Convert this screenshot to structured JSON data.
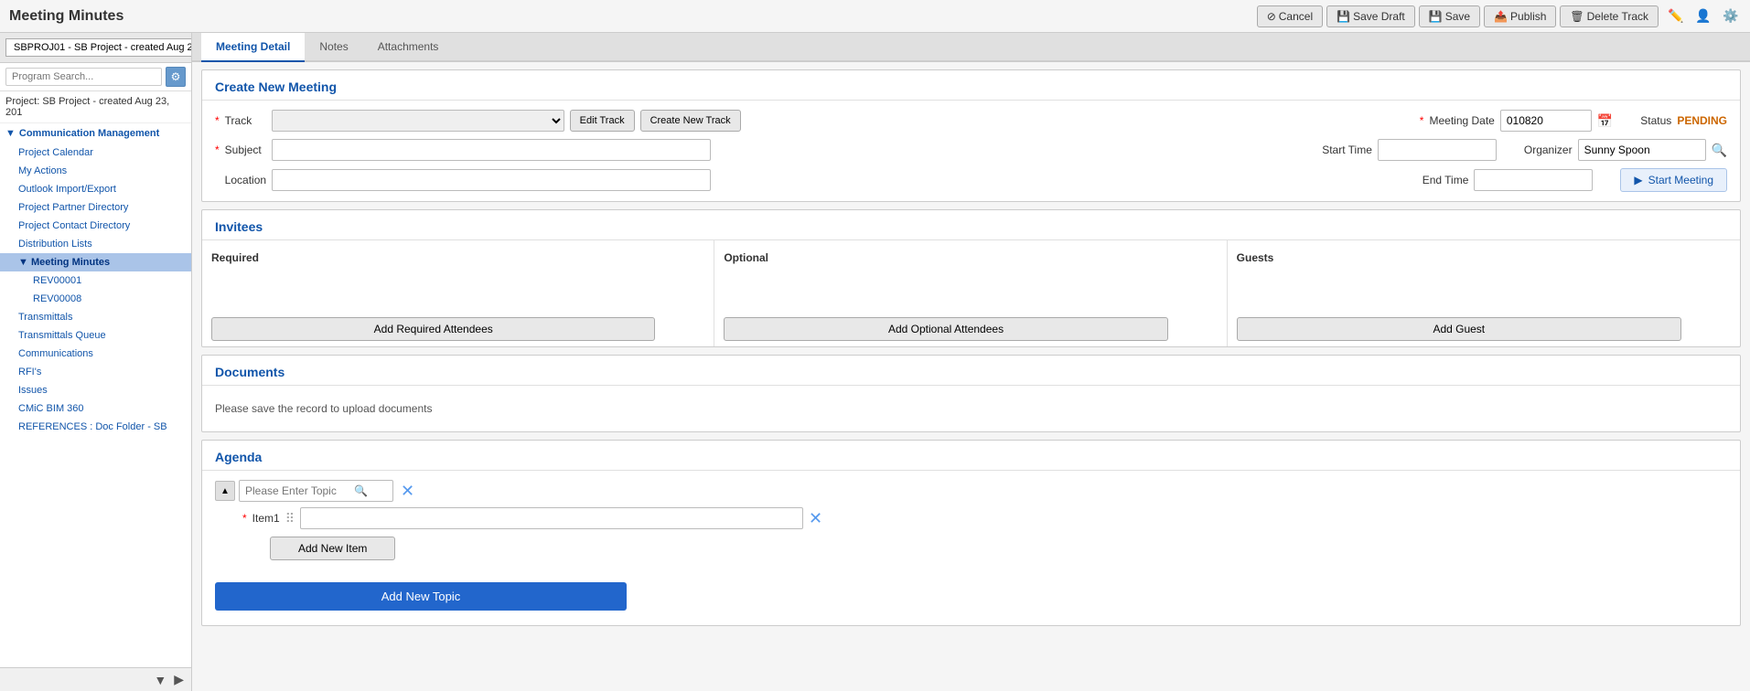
{
  "app": {
    "title": "Meeting Minutes"
  },
  "topbar": {
    "cancel_label": "Cancel",
    "save_draft_label": "Save Draft",
    "save_label": "Save",
    "publish_label": "Publish",
    "delete_track_label": "Delete Track"
  },
  "sidebar": {
    "project_selector": "SBPROJ01 - SB Project - created Aug 2...",
    "search_placeholder": "Program Search...",
    "project_label": "Project: SB Project - created Aug 23, 201",
    "groups": [
      {
        "label": "Communication Management",
        "expanded": true,
        "items": [
          {
            "label": "Project Calendar",
            "active": false
          },
          {
            "label": "My Actions",
            "active": false
          },
          {
            "label": "Outlook Import/Export",
            "active": false
          },
          {
            "label": "Project Partner Directory",
            "active": false
          },
          {
            "label": "Project Contact Directory",
            "active": false
          },
          {
            "label": "Distribution Lists",
            "active": false
          },
          {
            "label": "Meeting Minutes",
            "active": true,
            "subitems": [
              {
                "label": "REV00001"
              },
              {
                "label": "REV00008"
              }
            ]
          },
          {
            "label": "Transmittals",
            "active": false
          },
          {
            "label": "Transmittals Queue",
            "active": false
          },
          {
            "label": "Communications",
            "active": false
          },
          {
            "label": "RFI's",
            "active": false
          },
          {
            "label": "Issues",
            "active": false
          },
          {
            "label": "CMiC BIM 360",
            "active": false
          },
          {
            "label": "REFERENCES : Doc Folder - SB",
            "active": false
          }
        ]
      }
    ]
  },
  "tabs": [
    {
      "label": "Meeting Detail",
      "active": true
    },
    {
      "label": "Notes",
      "active": false
    },
    {
      "label": "Attachments",
      "active": false
    }
  ],
  "meeting_detail": {
    "section_title": "Create New Meeting",
    "track_label": "Track",
    "track_value": "",
    "edit_track_label": "Edit Track",
    "create_new_track_label": "Create New Track",
    "meeting_date_label": "Meeting Date",
    "meeting_date_value": "010820",
    "status_label": "Status",
    "status_value": "PENDING",
    "subject_label": "Subject",
    "subject_value": "",
    "start_time_label": "Start Time",
    "start_time_value": "",
    "organizer_label": "Organizer",
    "organizer_value": "Sunny Spoon",
    "location_label": "Location",
    "location_value": "",
    "end_time_label": "End Time",
    "end_time_value": "",
    "start_meeting_label": "Start Meeting"
  },
  "invitees": {
    "section_title": "Invitees",
    "required_label": "Required",
    "optional_label": "Optional",
    "guests_label": "Guests",
    "add_required_label": "Add Required Attendees",
    "add_optional_label": "Add Optional Attendees",
    "add_guest_label": "Add Guest"
  },
  "documents": {
    "section_title": "Documents",
    "note": "Please save the record to upload documents"
  },
  "agenda": {
    "section_title": "Agenda",
    "topic_placeholder": "Please Enter Topic",
    "item1_label": "Item1",
    "item1_value": "",
    "add_new_item_label": "Add New Item",
    "add_new_topic_label": "Add New Topic"
  }
}
